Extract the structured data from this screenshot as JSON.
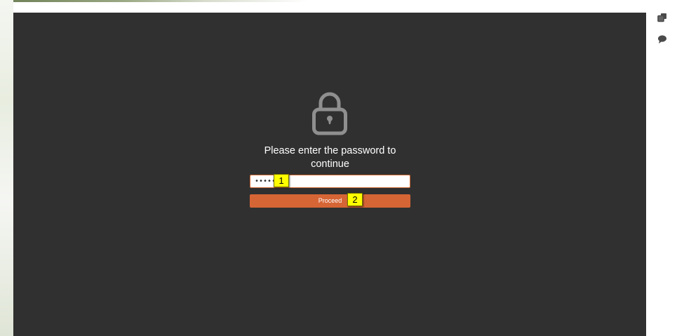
{
  "lock_screen": {
    "prompt": "Please enter the password to continue",
    "password_value": "••••••",
    "proceed_label": "Proceed"
  },
  "side_toolbar": {
    "icons": [
      "copy-icon",
      "comment-icon"
    ]
  },
  "annotations": [
    {
      "label": "1"
    },
    {
      "label": "2"
    }
  ],
  "colors": {
    "panel_background": "#303030",
    "accent": "#d66535",
    "marker": "#ffff00"
  }
}
